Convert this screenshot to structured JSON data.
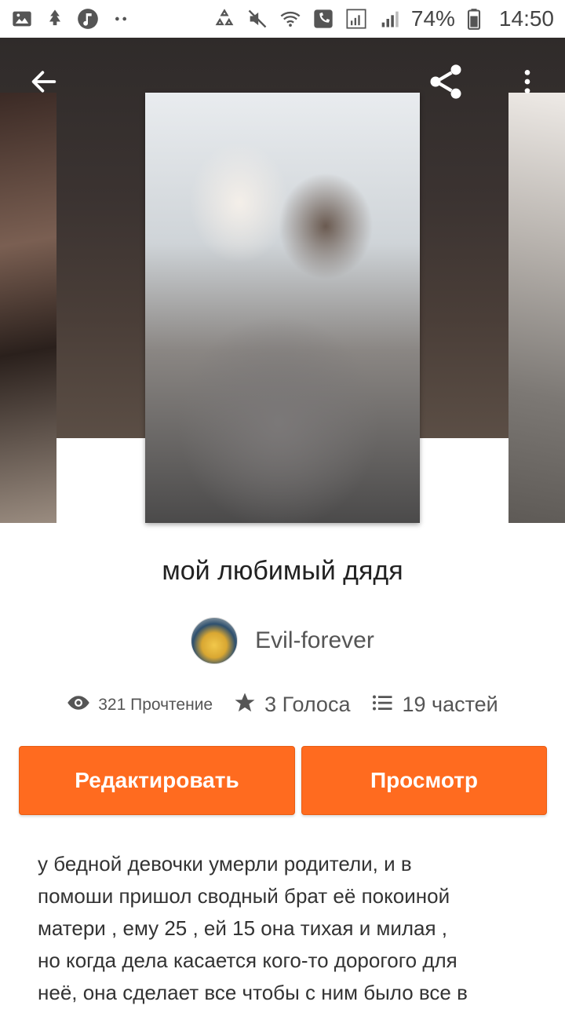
{
  "status_bar": {
    "battery": "74%",
    "time": "14:50",
    "icons": [
      "image-icon",
      "tree-icon",
      "music-icon",
      "dots-icon",
      "recycle-icon",
      "mute-icon",
      "wifi-icon",
      "phone-icon",
      "signal-icon",
      "signal-icon",
      "battery-icon"
    ]
  },
  "header": {
    "back_icon": "arrow-left-icon",
    "share_icon": "share-icon",
    "more_icon": "more-vertical-icon"
  },
  "story": {
    "title": "мой любимый дядя",
    "author": "Evil-forever",
    "stats": {
      "reads": "321 Прочтение",
      "votes": "3 Голоса",
      "parts": "19 частей"
    }
  },
  "actions": {
    "edit_label": "Редактировать",
    "preview_label": "Просмотр"
  },
  "description": {
    "lines": [
      "у бедной девочки умерли родители, и в",
      "помоши пришол сводный брат её покоиной",
      "матери , ему 25 , ей  15 она тихая и милая ,",
      "но когда дела касается кого-то дорогого для",
      "неё,  она сделает все чтобы с ним было все в"
    ]
  },
  "colors": {
    "accent": "#ff6b1f",
    "text": "#222222",
    "muted": "#555555"
  }
}
